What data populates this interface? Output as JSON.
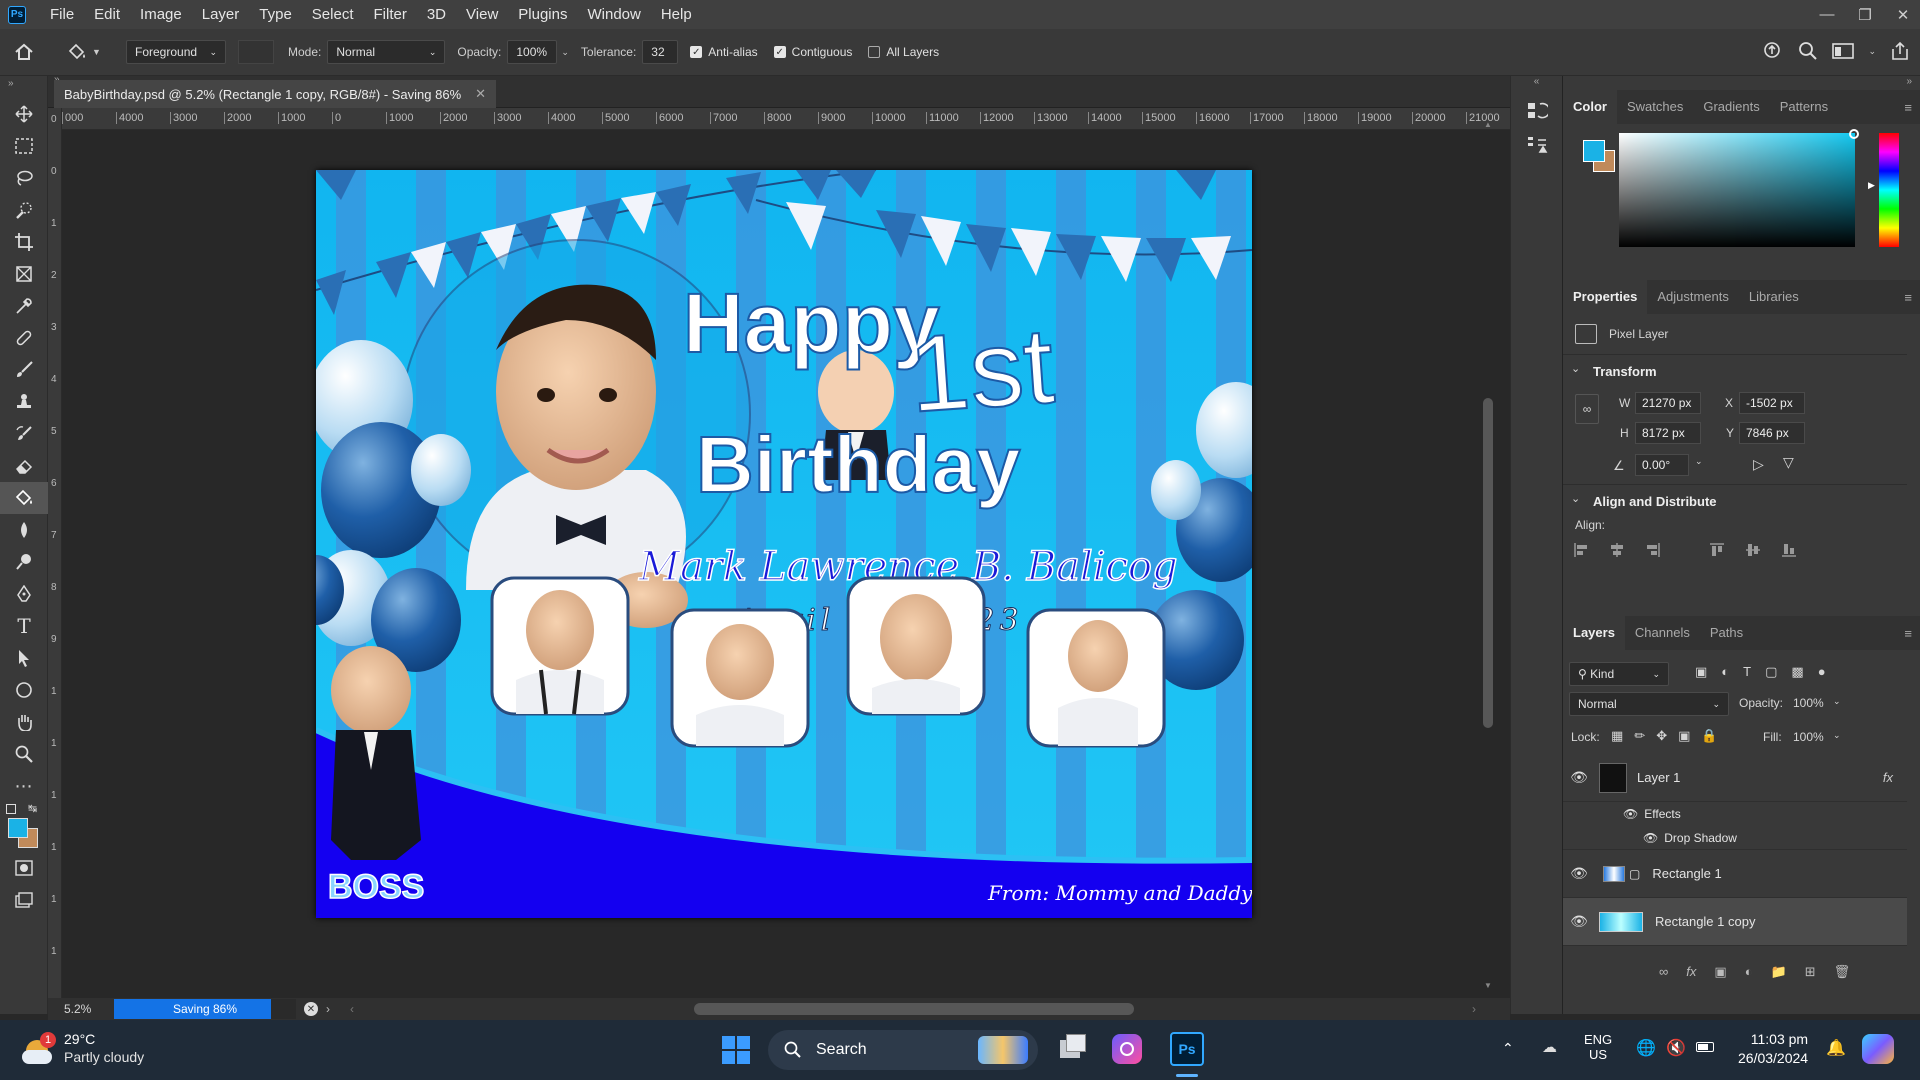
{
  "menubar": {
    "logo": "Ps",
    "items": [
      "File",
      "Edit",
      "Image",
      "Layer",
      "Type",
      "Select",
      "Filter",
      "3D",
      "View",
      "Plugins",
      "Window",
      "Help"
    ]
  },
  "options": {
    "fill_source": "Foreground",
    "mode_label": "Mode:",
    "mode_value": "Normal",
    "opacity_label": "Opacity:",
    "opacity_value": "100%",
    "tolerance_label": "Tolerance:",
    "tolerance_value": "32",
    "anti_alias_label": "Anti-alias",
    "anti_alias_checked": true,
    "contiguous_label": "Contiguous",
    "contiguous_checked": true,
    "all_layers_label": "All Layers",
    "all_layers_checked": false
  },
  "document": {
    "tab_title": "BabyBirthday.psd @ 5.2% (Rectangle 1 copy, RGB/8#) - Saving 86%",
    "ruler_ticks": [
      "000",
      "4000",
      "3000",
      "2000",
      "1000",
      "0",
      "1000",
      "2000",
      "3000",
      "4000",
      "5000",
      "6000",
      "7000",
      "8000",
      "9000",
      "10000",
      "11000",
      "12000",
      "13000",
      "14000",
      "15000",
      "16000",
      "17000",
      "18000",
      "19000",
      "20000",
      "21000",
      "2200"
    ],
    "vruler_ticks": [
      "0",
      "0",
      "1",
      "2",
      "3",
      "4",
      "5",
      "6",
      "7",
      "8",
      "9",
      "1",
      "1",
      "1",
      "1",
      "1",
      "1"
    ]
  },
  "artwork": {
    "title_happy": "Happy",
    "title_first": "1st",
    "title_birthday": "Birthday",
    "name": "Mark Lawrence B. Balicog",
    "date": "April 11, 2023",
    "from": "From: Mommy and Daddy",
    "brand": "BOSS"
  },
  "status": {
    "zoom": "5.2%",
    "progress_label": "Saving 86%",
    "progress": 0.86
  },
  "color_panel": {
    "tabs": [
      "Color",
      "Swatches",
      "Gradients",
      "Patterns"
    ],
    "foreground": "#1ab2e6",
    "background": "#c08a5a"
  },
  "properties": {
    "tabs": [
      "Properties",
      "Adjustments",
      "Libraries"
    ],
    "kind": "Pixel Layer",
    "transform_label": "Transform",
    "w_label": "W",
    "w_value": "21270 px",
    "x_label": "X",
    "x_value": "-1502 px",
    "h_label": "H",
    "h_value": "8172 px",
    "y_label": "Y",
    "y_value": "7846 px",
    "angle_value": "0.00°",
    "align_header": "Align and Distribute",
    "align_label": "Align:"
  },
  "layers": {
    "tabs": [
      "Layers",
      "Channels",
      "Paths"
    ],
    "kind_label": "Kind",
    "blend": "Normal",
    "opacity_label": "Opacity:",
    "opacity_value": "100%",
    "lock_label": "Lock:",
    "fill_label": "Fill:",
    "fill_value": "100%",
    "rows": [
      {
        "name": "Layer 1",
        "fx": "fx"
      },
      {
        "name": "Effects"
      },
      {
        "name": "Drop Shadow"
      },
      {
        "name": "Rectangle 1"
      },
      {
        "name": "Rectangle 1 copy"
      }
    ]
  },
  "taskbar": {
    "weather_temp": "29°C",
    "weather_desc": "Partly cloudy",
    "weather_badge": "1",
    "search_label": "Search",
    "lang_line1": "ENG",
    "lang_line2": "US",
    "time": "11:03 pm",
    "date": "26/03/2024"
  }
}
